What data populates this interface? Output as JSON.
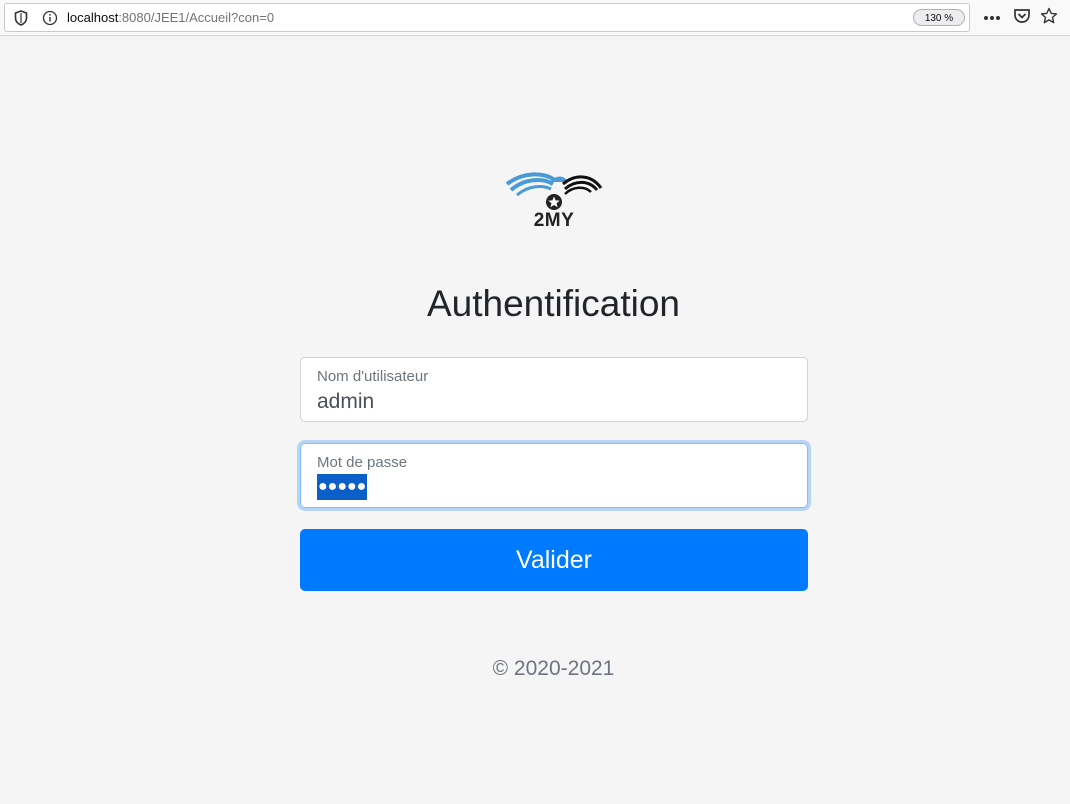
{
  "browser": {
    "url_host": "localhost",
    "url_rest": ":8080/JEE1/Accueil?con=0",
    "zoom": "130 %",
    "menu_dots": "•••"
  },
  "logo": {
    "text": "2MY"
  },
  "form": {
    "title": "Authentification",
    "username_label": "Nom d'utilisateur",
    "username_value": "admin",
    "password_label": "Mot de passe",
    "password_value": "●●●●●",
    "submit_label": "Valider"
  },
  "footer": {
    "text": "© 2020-2021"
  },
  "colors": {
    "accent": "#007bff",
    "background": "#f5f5f5",
    "logo_blue": "#4a9ad8"
  },
  "icons": [
    "shield-icon",
    "info-icon",
    "dots-icon",
    "pocket-icon",
    "star-icon",
    "logo-emblem"
  ]
}
